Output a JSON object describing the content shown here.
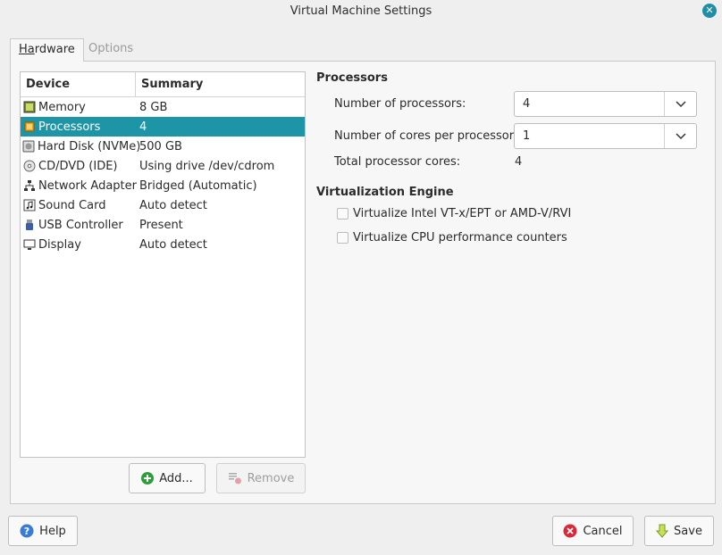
{
  "window": {
    "title": "Virtual Machine Settings"
  },
  "tabs": [
    {
      "label": "Hardware",
      "active": true
    },
    {
      "label": "Options",
      "active": false
    }
  ],
  "device_list": {
    "columns": [
      "Device",
      "Summary"
    ],
    "rows": [
      {
        "device": "Memory",
        "summary": "8 GB",
        "icon": "memory-icon"
      },
      {
        "device": "Processors",
        "summary": "4",
        "icon": "processor-icon",
        "selected": true
      },
      {
        "device": "Hard Disk (NVMe)",
        "summary": "500 GB",
        "icon": "hard-disk-icon"
      },
      {
        "device": "CD/DVD (IDE)",
        "summary": "Using drive /dev/cdrom",
        "icon": "cd-dvd-icon"
      },
      {
        "device": "Network Adapter",
        "summary": "Bridged (Automatic)",
        "icon": "network-icon"
      },
      {
        "device": "Sound Card",
        "summary": "Auto detect",
        "icon": "sound-card-icon"
      },
      {
        "device": "USB Controller",
        "summary": "Present",
        "icon": "usb-icon"
      },
      {
        "device": "Display",
        "summary": "Auto detect",
        "icon": "display-icon"
      }
    ]
  },
  "list_buttons": {
    "add": "Add...",
    "remove": "Remove"
  },
  "processors": {
    "title": "Processors",
    "num_processors_label": "Number of processors:",
    "num_processors_value": "4",
    "cores_label": "Number of cores per processor:",
    "cores_value": "1",
    "total_label": "Total processor cores:",
    "total_value": "4"
  },
  "virtualization": {
    "title": "Virtualization Engine",
    "option1": "Virtualize Intel VT-x/EPT or AMD-V/RVI",
    "option2": "Virtualize CPU performance counters",
    "option1_checked": false,
    "option2_checked": false
  },
  "footer": {
    "help": "Help",
    "cancel": "Cancel",
    "save": "Save"
  },
  "colors": {
    "accent": "#1e95a6",
    "close": "#1e8fa6",
    "add_icon": "#2e9e3c",
    "cancel_icon": "#d8283a"
  }
}
